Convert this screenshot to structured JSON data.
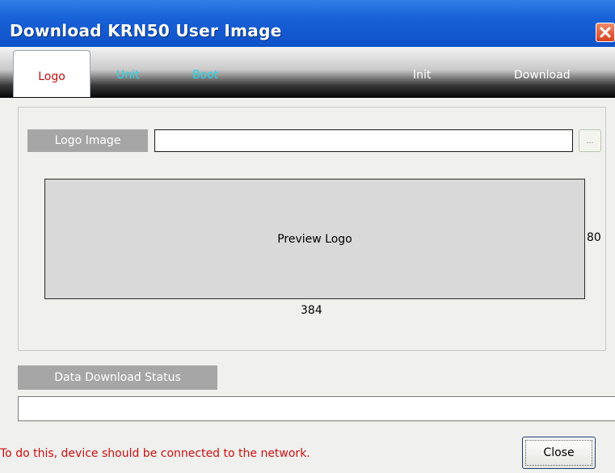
{
  "window": {
    "title": "Download KRN50 User Image"
  },
  "tabs": [
    {
      "label": "Logo",
      "active": true,
      "color": "#c01010"
    },
    {
      "label": "Unit",
      "active": false,
      "color": "#22d8e8"
    },
    {
      "label": "Boot",
      "active": false,
      "color": "#22d8e8"
    },
    {
      "label": "Init",
      "active": false,
      "color": "#ffffff"
    },
    {
      "label": "Download",
      "active": false,
      "color": "#ffffff"
    }
  ],
  "logo_section": {
    "label": "Logo Image",
    "input_value": "",
    "browse_label": "...",
    "preview_label": "Preview Logo",
    "width_label": "384",
    "height_label": "80"
  },
  "status_section": {
    "label": "Data Download Status",
    "value": ""
  },
  "footer": {
    "hint": "To do this, device should be connected to the network.",
    "close_label": "Close"
  },
  "colors": {
    "title_bar": "#1860d6",
    "hint_text": "#cc1010",
    "label_bg": "#a6a6a6"
  }
}
